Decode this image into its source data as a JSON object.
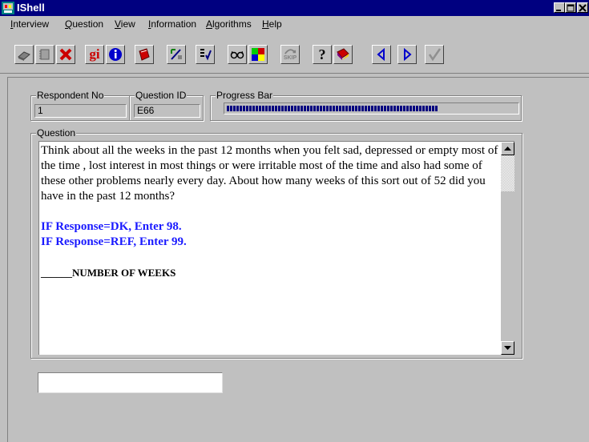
{
  "window": {
    "title": "IShell"
  },
  "menu": [
    {
      "label": "Interview",
      "ul": "I",
      "rest": "nterview"
    },
    {
      "label": "Question",
      "ul": "Q",
      "rest": "uestion"
    },
    {
      "label": "View",
      "ul": "V",
      "rest": "iew"
    },
    {
      "label": "Information",
      "ul": "I",
      "rest": "nformation"
    },
    {
      "label": "Algorithms",
      "ul": "A",
      "rest": "lgorithms"
    },
    {
      "label": "Help",
      "ul": "H",
      "rest": "elp"
    }
  ],
  "toolbar": {
    "icons": [
      "book-gray-icon",
      "notebook-gray-icon",
      "delete-x-icon",
      "gi-icon",
      "info-icon",
      "red-book-icon",
      "edit-icon",
      "checklist-icon",
      "glasses-icon",
      "color-grid-icon",
      "skip-icon",
      "help-icon",
      "guide-book-icon",
      "previous-icon",
      "next-icon",
      "accept-check-icon"
    ],
    "gi_label": "gi",
    "skip_label": "SKIP",
    "help_label": "?"
  },
  "fields": {
    "respondent_label": "Respondent No",
    "respondent_value": "1",
    "question_id_label": "Question ID",
    "question_id_value": "E66",
    "progress_label": "Progress Bar",
    "progress_fraction": 0.72
  },
  "question": {
    "label": "Question",
    "text": "Think about all the weeks in the past 12 months when you felt sad, depressed or empty most of the time , lost interest in most things or were irritable most of the time and also had some of these other problems nearly every day. About how many weeks of this sort out of 52 did you have in the past 12 months?",
    "instruction1": "IF Response=DK, Enter 98.",
    "instruction2": "IF Response=REF, Enter 99.",
    "blank": "______",
    "answer_caption": "NUMBER OF WEEKS"
  },
  "answer": {
    "value": ""
  },
  "colors": {
    "title_bar": "#000080",
    "instruction": "#1a1aff",
    "progress": "#000080"
  }
}
